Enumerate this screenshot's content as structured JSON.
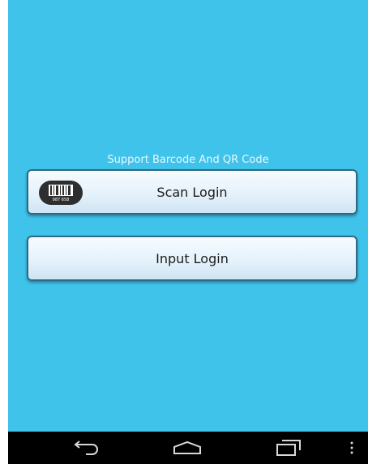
{
  "app": {
    "subtitle": "Support Barcode And QR Code",
    "buttons": {
      "scan_label": "Scan Login",
      "input_label": "Input Login"
    },
    "barcode_digits": "987 658"
  },
  "navbar": {
    "icons": [
      "back-icon",
      "home-icon",
      "recent-apps-icon",
      "menu-icon"
    ]
  },
  "colors": {
    "background": "#3fc3ea",
    "button_border": "#2b6a86",
    "navbar": "#000000"
  }
}
